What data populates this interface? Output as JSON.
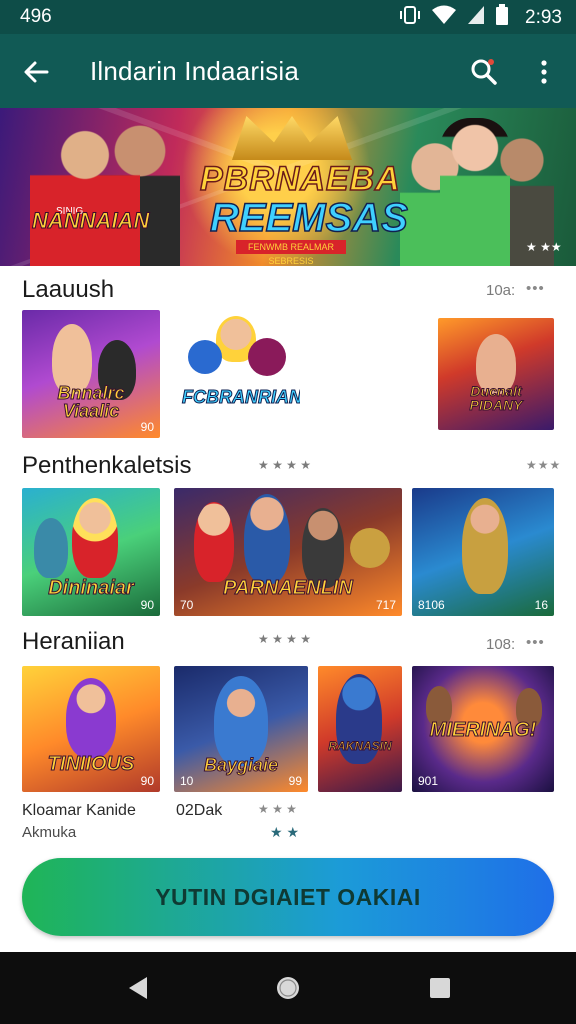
{
  "status_bar": {
    "left_text": "496",
    "time": "2:93"
  },
  "app_bar": {
    "title": "Ilndarin Indaarisia"
  },
  "banner": {
    "logo_line1": "PBRNAEBA",
    "logo_line2": "REEMSAS",
    "logo_tagline": "FENWMB REALMAR SEBRESIS",
    "left_logo": "NANNAIAN",
    "left_sub": "SINIG",
    "rating": "★ ★★"
  },
  "sections": [
    {
      "title": "Laauush",
      "meta": "10a:",
      "dots": "•••",
      "tiles": [
        {
          "art": "Bnnalrc Viaalic",
          "badge": "90"
        },
        {
          "art": "FCBRANRIAN",
          "badge": ""
        },
        {
          "art": "Ducnalt PIDANY",
          "badge": ""
        }
      ]
    },
    {
      "title": "Penthenkaletsis",
      "meta": "★ ★ ★ ★",
      "dots": "★★★",
      "tiles": [
        {
          "art": "Dininaiar",
          "badge": "90"
        },
        {
          "art": "PARNAENLIN",
          "badge": "717",
          "badge_left": "70"
        },
        {
          "art": "",
          "badge": "16",
          "badge_left": "8106"
        }
      ]
    },
    {
      "title": "Heraniian",
      "meta": "108:",
      "dots": "•••",
      "stars": "★ ★ ★ ★",
      "tiles": [
        {
          "art": "TINIIOUS",
          "badge": "90"
        },
        {
          "art": "Baygiaie",
          "badge": "99",
          "badge_left": "10"
        },
        {
          "art": "RAKNASIN",
          "badge": ""
        },
        {
          "art": "MIERINAG!",
          "badge": "",
          "badge_left": "901"
        }
      ],
      "caption_left": "Kloamar Kanide",
      "caption_left_sub": "Akmuka",
      "caption_mid": "02Dak",
      "caption_stars": "★ ★ ★",
      "caption_stars_2": "★ ★"
    }
  ],
  "cta": {
    "label": "YUTIN DGIAIET OAKIAI"
  },
  "colors": {
    "app_bar": "#115a55",
    "status_bar": "#0e4d48",
    "cta_start": "#1fb556",
    "cta_end": "#1f6fe8"
  },
  "icons": {
    "back": "arrow-left-icon",
    "search": "search-icon",
    "more": "more-vertical-icon",
    "nav_back": "triangle-back-icon",
    "nav_home": "circle-home-icon",
    "nav_recent": "square-recent-icon"
  }
}
